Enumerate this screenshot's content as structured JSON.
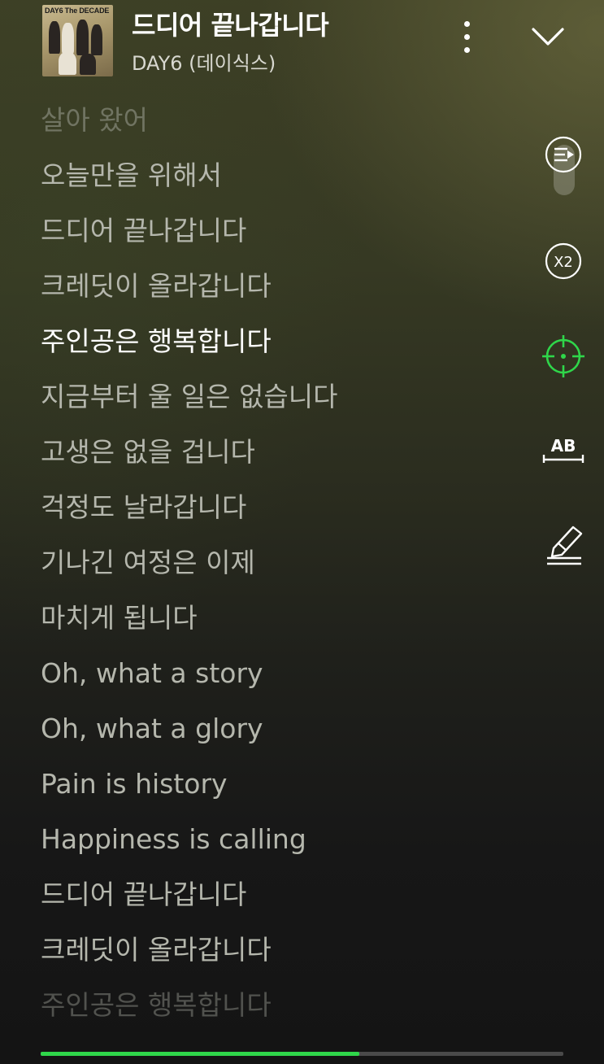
{
  "header": {
    "album_art_text": "DAY6 The DECADE",
    "title": "드디어 끝나갑니다",
    "artist": "DAY6 (데이식스)",
    "more_icon": "more-vertical-icon",
    "collapse_icon": "chevron-down-icon"
  },
  "lyrics": [
    "살아 왔어",
    "오늘만을 위해서",
    "드디어 끝나갑니다",
    "크레딧이 올라갑니다",
    "주인공은 행복합니다",
    "지금부터 울 일은 없습니다",
    "고생은 없을 겁니다",
    "걱정도 날라갑니다",
    "기나긴 여정은 이제",
    "마치게 됩니다",
    "Oh, what a story",
    "Oh, what a glory",
    "Pain is history",
    "Happiness is calling",
    "드디어 끝나갑니다",
    "크레딧이 올라갑니다",
    "주인공은 행복합니다"
  ],
  "active_lyric_index": 4,
  "toolbar": {
    "items": [
      {
        "icon": "lyrics-list-icon"
      },
      {
        "icon": "speed-icon",
        "label": "X2"
      },
      {
        "icon": "crosshair-icon"
      },
      {
        "icon": "text-size-icon",
        "label": "AB"
      },
      {
        "icon": "highlighter-icon"
      }
    ]
  },
  "progress": {
    "fraction": 0.61
  },
  "colors": {
    "accent": "#2fd64a",
    "active_lyric": "#ffffff",
    "inactive_lyric": "#b5b7ad"
  }
}
